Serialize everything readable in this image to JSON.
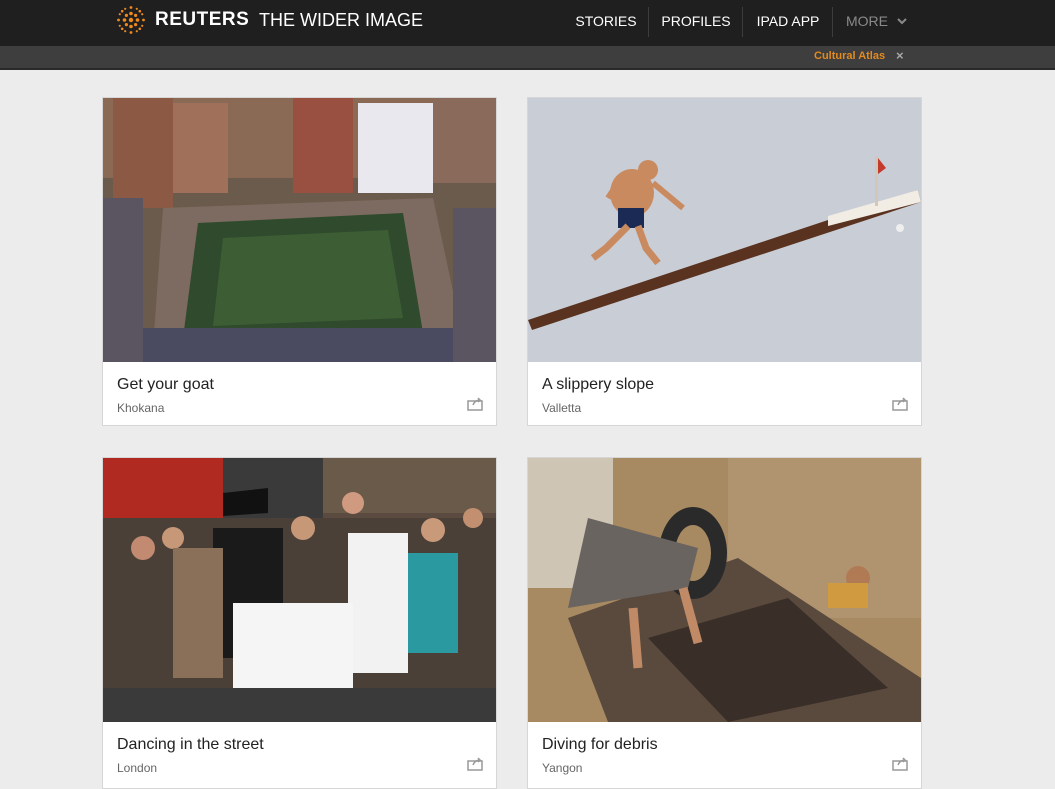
{
  "header": {
    "brand": "REUTERS",
    "subbrand": "THE WIDER IMAGE",
    "nav": [
      {
        "label": "STORIES"
      },
      {
        "label": "PROFILES"
      },
      {
        "label": "IPAD APP"
      },
      {
        "label": "MORE"
      }
    ],
    "logo_icon": "reuters-dots-logo",
    "more_icon": "chevron-down-icon",
    "accent_color": "#e38a1f"
  },
  "subbar": {
    "link": "Cultural Atlas",
    "close": "×"
  },
  "cards": [
    {
      "title": "Get your goat",
      "location": "Khokana",
      "image": "crowd-around-pond-photo"
    },
    {
      "title": "A slippery slope",
      "location": "Valletta",
      "image": "man-on-greasy-pole-photo"
    },
    {
      "title": "Dancing in the street",
      "location": "London",
      "image": "crowd-police-officer-photo"
    },
    {
      "title": "Diving for debris",
      "location": "Yangon",
      "image": "boat-river-debris-photo"
    }
  ]
}
